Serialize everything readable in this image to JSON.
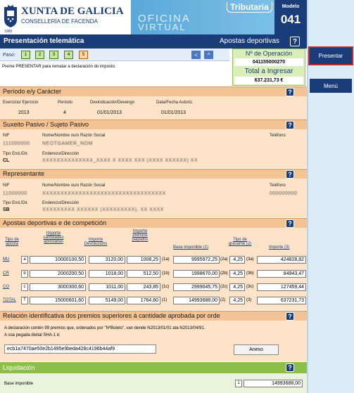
{
  "header": {
    "brand_title": "XUNTA DE GALICIA",
    "brand_subtitle": "CONSELLERÍA DE FACENDA",
    "brand_year": "1988",
    "banner_line1": "OFICINA",
    "banner_line2": "VIRTUAL",
    "banner_tag": "Tributaria",
    "model_label": "Modelo",
    "model_number": "041"
  },
  "sidebar": {
    "presentar_label": "Presentar",
    "menu_label": "Menú"
  },
  "titlebar": {
    "left": "Presentación telemática",
    "right": "Apostas deportivas",
    "help": "?"
  },
  "steps": {
    "label": "Paso:",
    "items": [
      "1",
      "2",
      "3",
      "4",
      "5"
    ],
    "prev": "<",
    "up": "^"
  },
  "instruction": "Preme PRESENTAR para rematar a declaración do imposto.",
  "operation": {
    "label": "Nº de Operación",
    "value": "041155000270",
    "total_label": "Total a Ingresar",
    "total_value": "637.231,73 €"
  },
  "periodo": {
    "title": "Período e/y Carácter",
    "exercicio_label": "Exercicio/ Ejercicio",
    "exercicio": "2013",
    "periodo_label": "Período",
    "periodo": "4",
    "devindicacion_label": "Devindicación/Devengo",
    "devindicacion": "01/01/2013",
    "autoriz_label": "Data/Fecha Autoriz.",
    "autoriz": "01/01/2013"
  },
  "suxeito": {
    "title": "Suxeito Pasivo / Sujeto Pasivo",
    "nif_label": "NIF",
    "nif": "111000000",
    "nombre_label": "Nome/Nombre ou/o Razón Social",
    "nombre": "NEOTGAMER_NOM",
    "telefono_label": "Teléfono",
    "tipo_label": "Tipo End./Dir.",
    "tipo": "CL",
    "enderezo_label": "Enderezo/Dirección",
    "enderezo": "XXXXXXXXXXXXXX_XXXX X XXXX XXX (XXXX XXXXXX) XX"
  },
  "representante": {
    "title": "Representante",
    "nif_label": "NIF",
    "nif": "11000000",
    "nombre_label": "Nome/Nombre ou/o Razón Social",
    "nombre": "XXXXXXXXXXXXXXXXXXXXXXXXXXXXXXXXXX",
    "telefono_label": "Teléfono",
    "telefono": "000000000",
    "tipo_label": "Tipo End./Dir.",
    "tipo": "SB",
    "enderezo_label": "Enderezo/Dirección",
    "enderezo": "XXXXXXXXX XXXXXX (XXXXXXXXX), XX XXXX"
  },
  "apostas": {
    "title": "Apostas deportivas e de competición",
    "headers": {
      "tipo": "Tipo de aposta",
      "importe_cantidades": "Importe cantidades apostadas",
      "importe_devolucions": "Importe Devolucións",
      "importe_premios": "Importe premios pagados",
      "base": "Base imponible (1)",
      "tipo_gravame": "Tipo de gravame (2)",
      "importe": "Importe (3)"
    },
    "rows": [
      {
        "code": "MU",
        "key": "a",
        "cantidades": "10000100,50",
        "devolucions": "3120,00",
        "premios": "1008,25",
        "pkey": "(1a)",
        "base": "9995972,25",
        "bkey": "(2a)",
        "tipo": "4,25",
        "tkey": "(3a)",
        "importe": "424828,82"
      },
      {
        "code": "CR",
        "key": "b",
        "cantidades": "2000200,50",
        "devolucions": "1018,00",
        "premios": "512,50",
        "pkey": "(1b)",
        "base": "1998670,00",
        "bkey": "(2b)",
        "tipo": "4,25",
        "tkey": "(3b)",
        "importe": "84943,47"
      },
      {
        "code": "CO",
        "key": "c",
        "cantidades": "3000300,60",
        "devolucions": "1011,00",
        "premios": "243,85",
        "pkey": "(1c)",
        "base": "2999045,75",
        "bkey": "(2c)",
        "tipo": "4,25",
        "tkey": "(3c)",
        "importe": "127459,44"
      },
      {
        "code": "TOTAL",
        "key": "T",
        "cantidades": "15000601,60",
        "devolucions": "5149,00",
        "premios": "1764,60",
        "pkey": "(1)",
        "base": "14993688,00",
        "bkey": "(2)",
        "tipo": "4,25",
        "tkey": "(3)",
        "importe": "637231,73"
      }
    ]
  },
  "relacion": {
    "title": "Relación identificativa dos premios superiores á cantidade aprobada por orde",
    "line1": "A declaración contén 99 premios que, ordenados por \"NºBoleto\", van dende N2013/01/01 ata N2013/04/91.",
    "line2": "A súa pegada dixital SHA-1 é:",
    "hash": "ecb1a7470ae50e2b1495e9beda428c4196b44af9",
    "anexo_label": "Anexo"
  },
  "liquidacion": {
    "title": "Liquidación",
    "base_label": "Base imponible",
    "base_key": "1",
    "base_value": "14993688,00"
  },
  "colors": {
    "brand_blue": "#1a3d7a",
    "section_orange": "#f4c393",
    "section_body": "#fde3c7",
    "green": "#8bbf4a",
    "highlight_red": "#c62828"
  }
}
